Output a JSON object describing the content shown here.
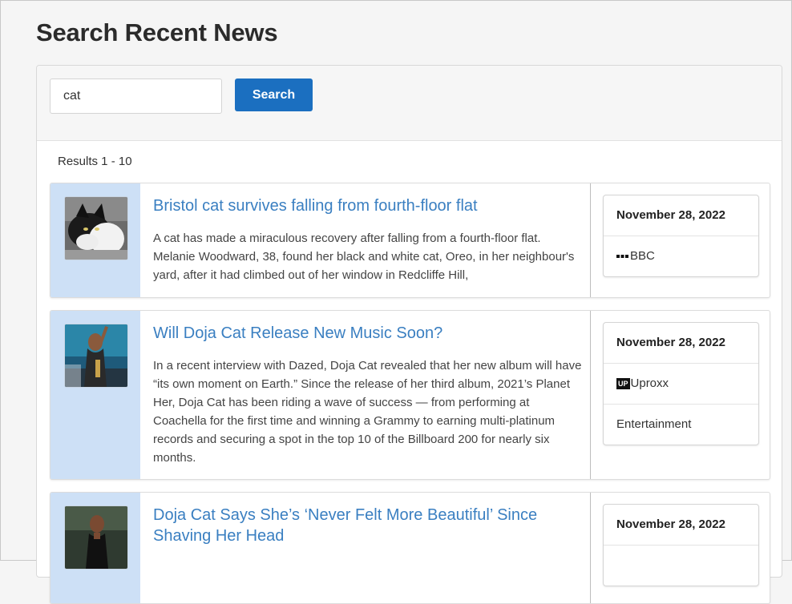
{
  "page": {
    "title": "Search Recent News"
  },
  "search": {
    "value": "cat",
    "button_label": "Search"
  },
  "results": {
    "count_label": "Results 1 - 10",
    "items": [
      {
        "title": "Bristol cat survives falling from fourth-floor flat",
        "description": "A cat has made a miraculous recovery after falling from a fourth-floor flat. Melanie Woodward, 38, found her black and white cat, Oreo, in her neighbour's yard, after it had climbed out of her window in Redcliffe Hill,",
        "date": "November 28, 2022",
        "source": "BBC",
        "source_icon": "bbc-logo-icon",
        "thumbnail": "black-and-white-cat-photo",
        "category": ""
      },
      {
        "title": "Will Doja Cat Release New Music Soon?",
        "description": "In a recent interview with Dazed, Doja Cat revealed that her new album will have “its own moment on Earth.” Since the release of her third album, 2021’s Planet Her, Doja Cat has been riding a wave of success — from performing at Coachella for the first time and winning a Grammy to earning multi-platinum records and securing a spot in the top 10 of the Billboard 200 for nearly six months.",
        "date": "November 28, 2022",
        "source": "Uproxx",
        "source_icon_text": "UP",
        "source_icon": "uproxx-logo-icon",
        "thumbnail": "doja-cat-stage-photo",
        "category": "Entertainment"
      },
      {
        "title": "Doja Cat Says She’s ‘Never Felt More Beautiful’ Since Shaving Her Head",
        "description": "",
        "date": "November 28, 2022",
        "source": "",
        "source_icon": "",
        "thumbnail": "doja-cat-red-carpet-photo",
        "category": ""
      }
    ]
  },
  "colors": {
    "accent": "#1b6fc0",
    "link": "#3a7fc1",
    "thumb_bg": "#cde0f6"
  }
}
